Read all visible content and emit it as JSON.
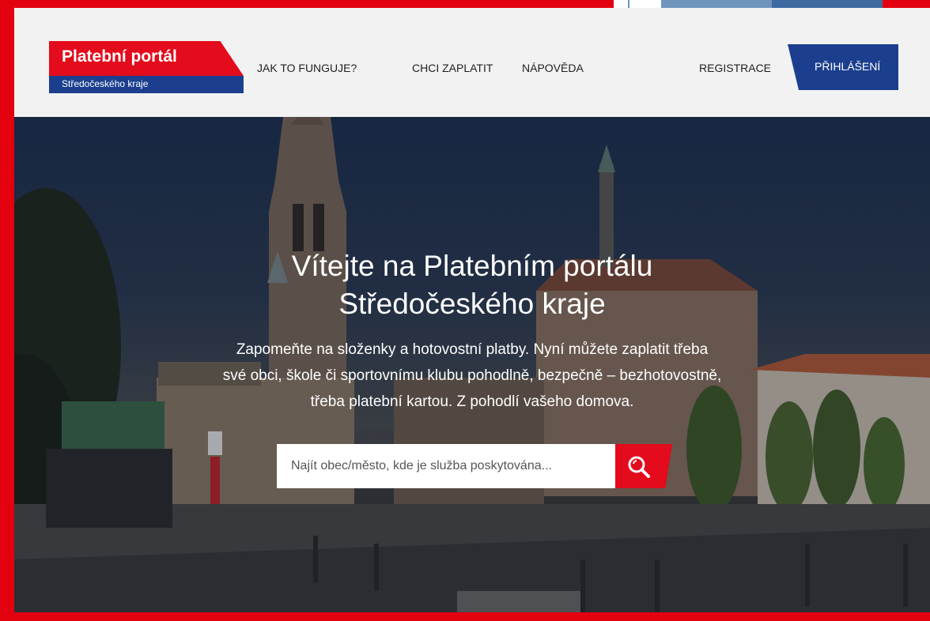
{
  "brand": {
    "title": "Platební portál",
    "subtitle": "Středočeského kraje",
    "red": "#e30b1c",
    "blue": "#1b3f8e"
  },
  "nav": {
    "items": [
      "JAK TO FUNGUJE?",
      "CHCI ZAPLATIT",
      "NÁPOVĚDA"
    ],
    "register": "REGISTRACE",
    "login": "PŘIHLÁŠENÍ"
  },
  "hero": {
    "title_line1": "Vítejte na Platebním portálu",
    "title_line2": "Středočeského kraje",
    "text_line1": "Zapomeňte na složenky a hotovostní platby. Nyní můžete zaplatit třeba",
    "text_line2": "své obci, škole či sportovnímu klubu pohodlně, bezpečně – bezhotovostně,",
    "text_line3": "třeba platební kartou. Z pohodlí vašeho domova."
  },
  "search": {
    "placeholder": "Najít obec/město, kde je služba poskytována...",
    "value": "",
    "icon": "search-icon"
  },
  "frame": {
    "color": "#e3000f"
  }
}
